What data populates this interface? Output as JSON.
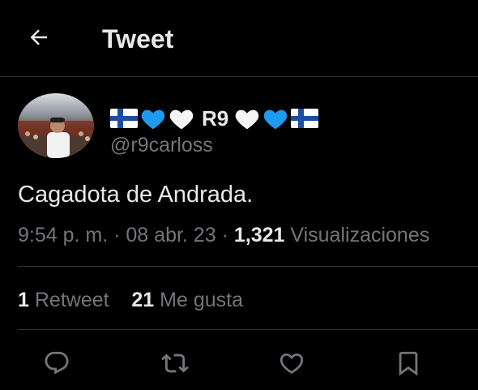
{
  "header": {
    "title": "Tweet",
    "back_icon": "arrow-left-icon"
  },
  "tweet": {
    "author": {
      "display_name": "R9",
      "handle": "@r9carloss",
      "name_emojis_before": [
        "flag-finland",
        "blue-heart",
        "white-heart"
      ],
      "name_emojis_after": [
        "white-heart",
        "blue-heart",
        "flag-finland"
      ]
    },
    "text": "Cagadota de Andrada.",
    "time": "9:54 p. m.",
    "date": "08 abr. 23",
    "views_count": "1,321",
    "views_label": "Visualizaciones",
    "separator": "·"
  },
  "stats": {
    "retweets_count": "1",
    "retweets_label": "Retweet",
    "likes_count": "21",
    "likes_label": "Me gusta"
  },
  "actions": [
    "reply-icon",
    "retweet-icon",
    "like-icon",
    "bookmark-icon"
  ],
  "colors": {
    "background": "#000000",
    "text_primary": "#e7e9ea",
    "text_secondary": "#71767b",
    "divider": "#2f3336",
    "blue_heart": "#1d9bf0",
    "white_heart": "#f5f5f5",
    "flag_blue": "#1c4fa0"
  }
}
